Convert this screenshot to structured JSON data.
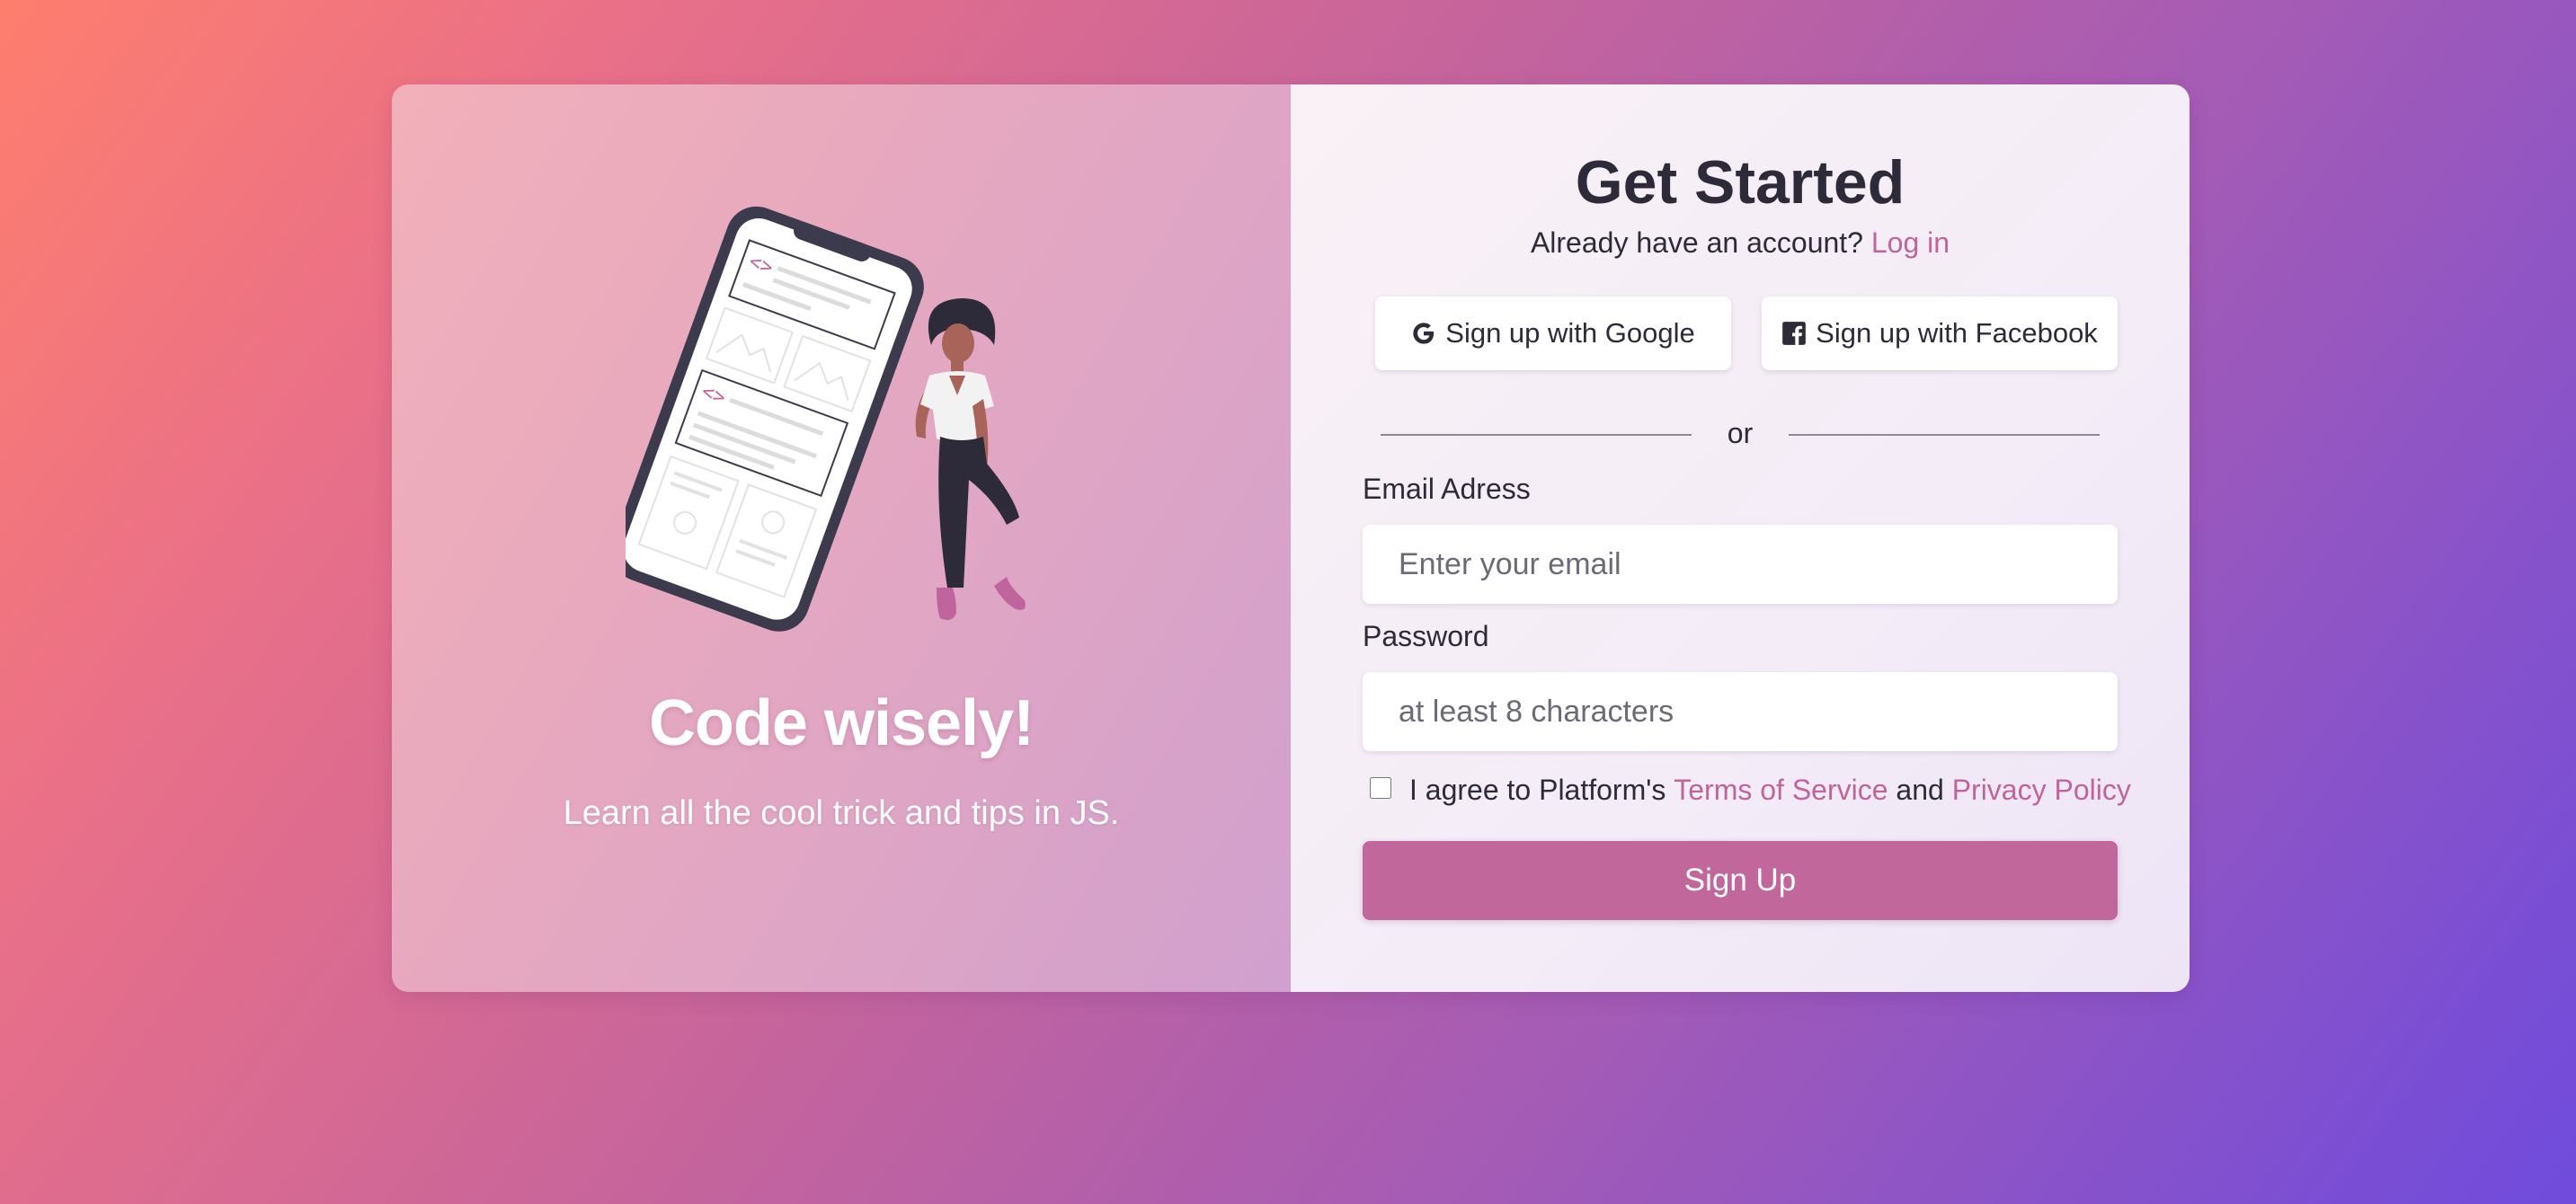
{
  "theme": {
    "accent": "#c0649d",
    "button_bg": "#c2679c",
    "text_dark": "#2d2a3a"
  },
  "hero": {
    "title": "Code wisely!",
    "subtitle": "Learn all the cool trick and tips in JS.",
    "illustration": "woman-leaning-on-phone-illustration"
  },
  "form": {
    "title": "Get Started",
    "login_prompt": "Already have an account?",
    "login_link": "Log in",
    "social": {
      "google_label": "Sign up with Google",
      "google_icon": "google-icon",
      "facebook_label": "Sign up with Facebook",
      "facebook_icon": "facebook-icon"
    },
    "divider_text": "or",
    "email": {
      "label": "Email Adress",
      "placeholder": "Enter your email",
      "value": ""
    },
    "password": {
      "label": "Password",
      "placeholder": "at least 8 characters",
      "value": ""
    },
    "agreement": {
      "checked": false,
      "prefix": "I agree to Platform's",
      "terms_link": "Terms of Service",
      "conjunction": "and",
      "privacy_link": "Privacy Policy"
    },
    "submit_label": "Sign Up"
  }
}
